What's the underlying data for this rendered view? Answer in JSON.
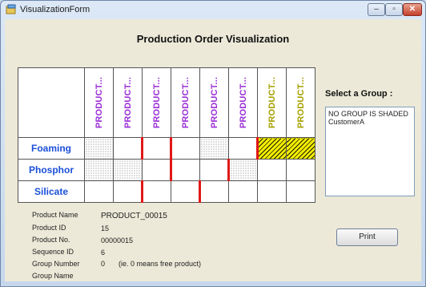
{
  "window": {
    "title": "VisualizationForm",
    "min_label": "–",
    "max_label": "▫",
    "close_label": "✕"
  },
  "form": {
    "title": "Production Order Visualization"
  },
  "grid": {
    "columns": [
      {
        "label": "PRODUCT...",
        "color": "#9b2fd6"
      },
      {
        "label": "PRODUCT...",
        "color": "#9b2fd6"
      },
      {
        "label": "PRODUCT...",
        "color": "#9b2fd6"
      },
      {
        "label": "PRODUCT...",
        "color": "#9b2fd6"
      },
      {
        "label": "PRODUCT...",
        "color": "#9b2fd6"
      },
      {
        "label": "PRODUCT...",
        "color": "#9b2fd6"
      },
      {
        "label": "PRODUCT...",
        "color": "#a6a000"
      },
      {
        "label": "PRODUCT...",
        "color": "#a6a000"
      }
    ],
    "rows": [
      {
        "label": "Foaming",
        "cells": [
          "dot",
          "red",
          "red",
          "none",
          "dot",
          "red",
          "hatch",
          "hatch"
        ]
      },
      {
        "label": "Phosphor",
        "cells": [
          "dot",
          "dot",
          "red",
          "none",
          "red",
          "dot",
          "none",
          "none"
        ]
      },
      {
        "label": "Silicate",
        "cells": [
          "none",
          "red",
          "none",
          "red",
          "none",
          "none",
          "none",
          "none"
        ]
      }
    ]
  },
  "group": {
    "label": "Select a Group :",
    "items": [
      "NO GROUP IS SHADED",
      "CustomerA"
    ]
  },
  "info": [
    {
      "label": "Product Name",
      "value": "PRODUCT_00015",
      "note": ""
    },
    {
      "label": "Product ID",
      "value": "15",
      "note": ""
    },
    {
      "label": "Product No.",
      "value": "00000015",
      "note": ""
    },
    {
      "label": "Sequence ID",
      "value": "6",
      "note": ""
    },
    {
      "label": "Group Number",
      "value": "0",
      "note": "(ie. 0 means free product)"
    },
    {
      "label": "Group Name",
      "value": "",
      "note": ""
    }
  ],
  "print_button": {
    "label": "Print"
  }
}
